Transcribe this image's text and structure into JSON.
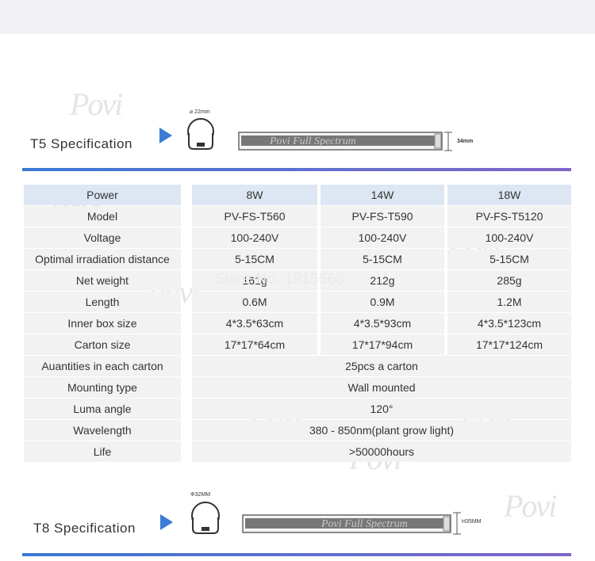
{
  "t5": {
    "title": "T5 Specification",
    "diameter": "⌀ 22mm",
    "tube_text": "Povi Full Spectrum",
    "height": "34mm"
  },
  "t8": {
    "title": "T8 Specification",
    "diameter": "Φ32MM",
    "tube_text": "Povi Full Spectrum",
    "height": "H35MM"
  },
  "table": {
    "header": {
      "label": "Power",
      "v1": "8W",
      "v2": "14W",
      "v3": "18W"
    },
    "rows": [
      {
        "label": "Model",
        "v1": "PV-FS-T560",
        "v2": "PV-FS-T590",
        "v3": "PV-FS-T5120"
      },
      {
        "label": "Voltage",
        "v1": "100-240V",
        "v2": "100-240V",
        "v3": "100-240V"
      },
      {
        "label": "Optimal irradiation distance",
        "v1": "5-15CM",
        "v2": "5-15CM",
        "v3": "5-15CM"
      },
      {
        "label": "Net weight",
        "v1": "161g",
        "v2": "212g",
        "v3": "285g"
      },
      {
        "label": "Length",
        "v1": "0.6M",
        "v2": "0.9M",
        "v3": "1.2M"
      },
      {
        "label": "Inner box size",
        "v1": "4*3.5*63cm",
        "v2": "4*3.5*93cm",
        "v3": "4*3.5*123cm"
      },
      {
        "label": "Carton size",
        "v1": "17*17*64cm",
        "v2": "17*17*94cm",
        "v3": "17*17*124cm"
      }
    ],
    "span_rows": [
      {
        "label": "Auantities in each carton",
        "value": "25pcs a carton"
      },
      {
        "label": "Mounting type",
        "value": "Wall mounted"
      },
      {
        "label": "Luma angle",
        "value": "120°"
      },
      {
        "label": "Wavelength",
        "value": "380 - 850nm(plant grow light)"
      },
      {
        "label": "Life",
        "value": ">50000hours"
      }
    ]
  },
  "watermarks": {
    "brand": "Povi",
    "store": "Store No: 1915568"
  },
  "colors": {
    "accent": "#3b7bd6",
    "gradient_end": "#8066c8",
    "header_bg": "#dde6f3",
    "cell_bg": "#f2f2f2"
  }
}
